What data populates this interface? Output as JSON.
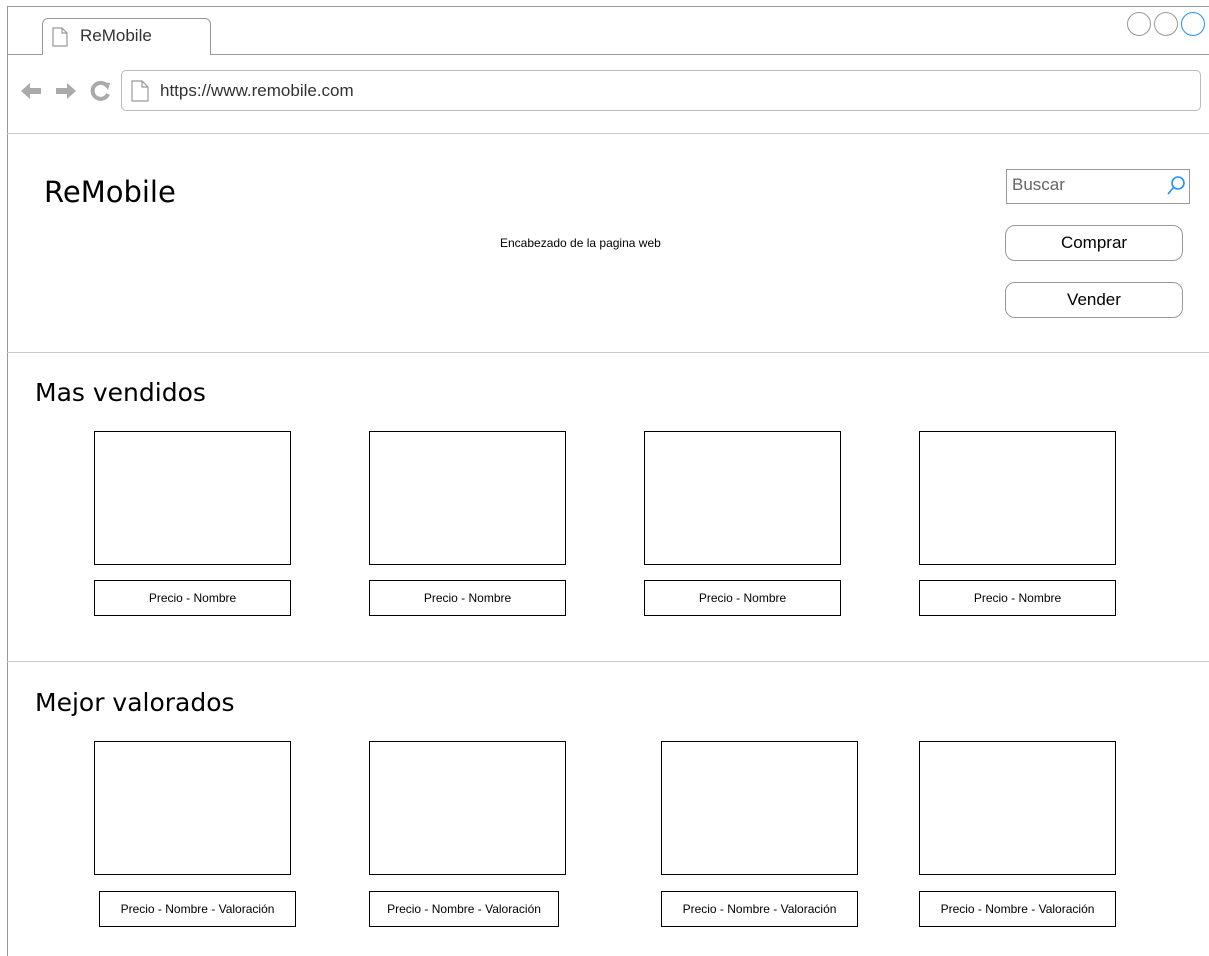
{
  "browser": {
    "tab_title": "ReMobile",
    "url": "https://www.remobile.com",
    "window_controls": [
      "minimize-icon",
      "maximize-icon",
      "close-icon"
    ],
    "nav_icons": [
      "back-arrow-icon",
      "forward-arrow-icon",
      "reload-icon"
    ],
    "accent_color": "#1e90ff"
  },
  "header": {
    "logo": "ReMobile",
    "caption": "Encabezado de la pagina web",
    "search_placeholder": "Buscar",
    "buy_label": "Comprar",
    "sell_label": "Vender"
  },
  "best_sellers": {
    "title": "Mas vendidos",
    "items": [
      {
        "caption": "Precio - Nombre"
      },
      {
        "caption": "Precio - Nombre"
      },
      {
        "caption": "Precio - Nombre"
      },
      {
        "caption": "Precio - Nombre"
      }
    ]
  },
  "top_rated": {
    "title": "Mejor valorados",
    "items": [
      {
        "caption": "Precio - Nombre - Valoración"
      },
      {
        "caption": "Precio - Nombre - Valoración"
      },
      {
        "caption": "Precio - Nombre - Valoración"
      },
      {
        "caption": "Precio - Nombre - Valoración"
      }
    ]
  }
}
